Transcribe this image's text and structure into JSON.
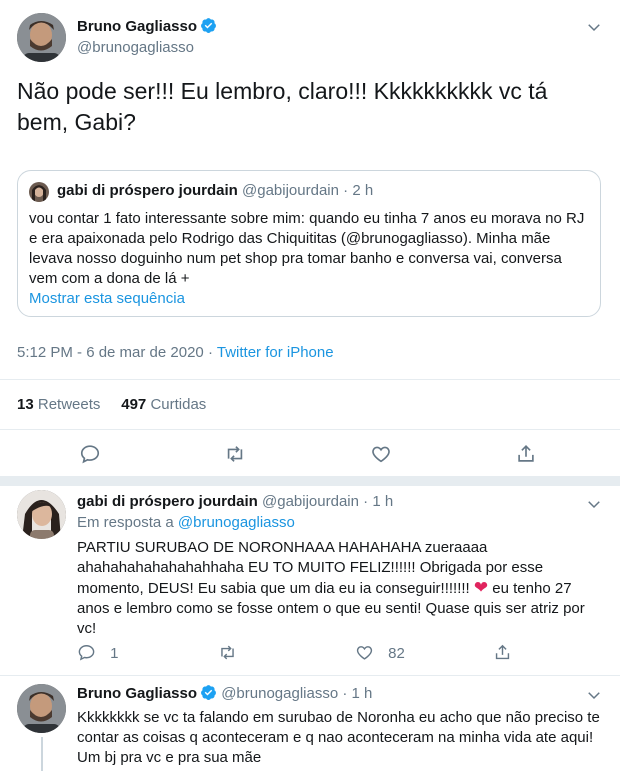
{
  "main_tweet": {
    "author_name": "Bruno Gagliasso",
    "author_handle": "@brunogagliasso",
    "text": "Não pode ser!!! Eu lembro, claro!!! Kkkkkkkkkk vc tá bem, Gabi?",
    "quoted": {
      "author_name": "gabi di próspero jourdain",
      "author_handle": "@gabijourdain",
      "separator": "·",
      "time": "2 h",
      "text": "vou contar 1 fato interessante sobre mim: quando eu tinha 7 anos eu morava no RJ e era apaixonada pelo Rodrigo das Chiquititas (@brunogagliasso). Minha mãe levava nosso doguinho num pet shop pra tomar banho e conversa vai, conversa vem com a dona de lá +",
      "show_thread": "Mostrar esta sequência"
    },
    "timestamp": "5:12 PM - 6 de mar de 2020",
    "meta_separator": "·",
    "source": "Twitter for iPhone",
    "retweets_count": "13",
    "retweets_label": "Retweets",
    "likes_count": "497",
    "likes_label": "Curtidas"
  },
  "replies": [
    {
      "author_name": "gabi di próspero jourdain",
      "author_handle": "@gabijourdain",
      "separator": "·",
      "time": "1 h",
      "reply_prefix": "Em resposta a",
      "reply_mention": "@brunogagliasso",
      "text_before_emoji": "PARTIU SURUBAO DE NORONHAAA HAHAHAHA zueraaaa ahahahahahahahahhaha EU TO MUITO FELIZ!!!!!! Obrigada por esse momento, DEUS! Eu sabia que um dia eu ia conseguir!!!!!!! ",
      "emoji": "❤",
      "text_after_emoji": " eu tenho 27 anos e lembro como se fosse ontem o que eu senti! Quase quis ser atriz por vc!",
      "reply_count": "1",
      "like_count": "82"
    },
    {
      "author_name": "Bruno Gagliasso",
      "author_handle": "@brunogagliasso",
      "separator": "·",
      "time": "1 h",
      "text": "Kkkkkkkk se vc ta falando em surubao de Noronha eu acho que não preciso te contar as coisas q aconteceram e q nao aconteceram na minha vida ate aqui! Um bj pra vc e pra sua mãe"
    }
  ],
  "colors": {
    "link_blue": "#1b95e0",
    "verified_blue": "#1da1f2",
    "secondary_text": "#657786",
    "heart_red": "#e0245e"
  },
  "icons": [
    "reply-icon",
    "retweet-icon",
    "like-icon",
    "share-icon",
    "verified-badge-icon",
    "chevron-down-icon"
  ]
}
